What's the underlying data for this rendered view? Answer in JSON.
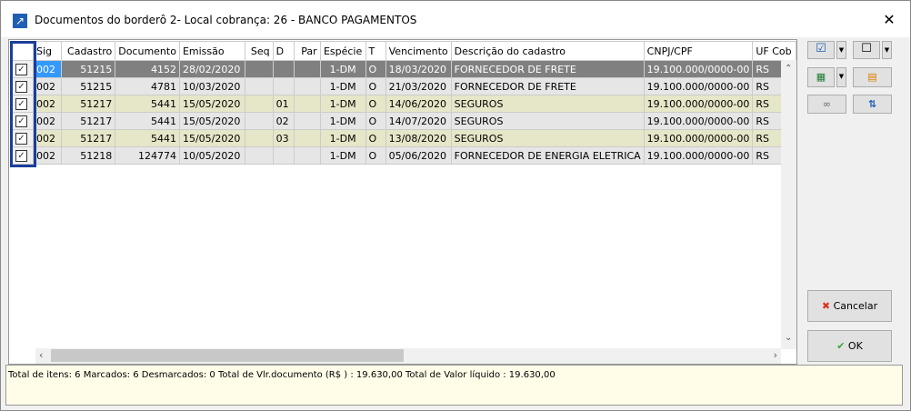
{
  "window": {
    "title": "Documentos do borderô 2- Local cobrança: 26 - BANCO PAGAMENTOS",
    "close": "✕"
  },
  "grid": {
    "headers": [
      "",
      "Sig",
      "Cadastro",
      "Documento",
      "Emissão",
      "Seq",
      "D",
      "Par",
      "Espécie",
      "T",
      "Vencimento",
      "Descrição do cadastro",
      "CNPJ/CPF",
      "UF Cob"
    ],
    "rows": [
      {
        "checked": true,
        "sig": "002",
        "cadastro": "51215",
        "documento": "4152",
        "emissao": "28/02/2020",
        "seq": "",
        "d": "",
        "par": "",
        "especie": "1-DM",
        "t": "O",
        "vencimento": "18/03/2020",
        "descricao": "FORNECEDOR DE FRETE",
        "cnpj": "19.100.000/0000-00",
        "uf": "RS"
      },
      {
        "checked": true,
        "sig": "002",
        "cadastro": "51215",
        "documento": "4781",
        "emissao": "10/03/2020",
        "seq": "",
        "d": "",
        "par": "",
        "especie": "1-DM",
        "t": "O",
        "vencimento": "21/03/2020",
        "descricao": "FORNECEDOR DE FRETE",
        "cnpj": "19.100.000/0000-00",
        "uf": "RS"
      },
      {
        "checked": true,
        "sig": "002",
        "cadastro": "51217",
        "documento": "5441",
        "emissao": "15/05/2020",
        "seq": "",
        "d": "01",
        "par": "",
        "especie": "1-DM",
        "t": "O",
        "vencimento": "14/06/2020",
        "descricao": "SEGUROS",
        "cnpj": "19.100.000/0000-00",
        "uf": "RS"
      },
      {
        "checked": true,
        "sig": "002",
        "cadastro": "51217",
        "documento": "5441",
        "emissao": "15/05/2020",
        "seq": "",
        "d": "02",
        "par": "",
        "especie": "1-DM",
        "t": "O",
        "vencimento": "14/07/2020",
        "descricao": "SEGUROS",
        "cnpj": "19.100.000/0000-00",
        "uf": "RS"
      },
      {
        "checked": true,
        "sig": "002",
        "cadastro": "51217",
        "documento": "5441",
        "emissao": "15/05/2020",
        "seq": "",
        "d": "03",
        "par": "",
        "especie": "1-DM",
        "t": "O",
        "vencimento": "13/08/2020",
        "descricao": "SEGUROS",
        "cnpj": "19.100.000/0000-00",
        "uf": "RS"
      },
      {
        "checked": true,
        "sig": "002",
        "cadastro": "51218",
        "documento": "124774",
        "emissao": "10/05/2020",
        "seq": "",
        "d": "",
        "par": "",
        "especie": "1-DM",
        "t": "O",
        "vencimento": "05/06/2020",
        "descricao": "FORNECEDOR DE ENERGIA ELETRICA",
        "cnpj": "19.100.000/0000-00",
        "uf": "RS"
      }
    ]
  },
  "status": "Total de itens: 6 Marcados: 6 Desmarcados: 0 Total de Vlr.documento (R$ ) : 19.630,00 Total de Valor líquido : 19.630,00",
  "buttons": {
    "cancel": "Cancelar",
    "ok": "OK"
  },
  "colors": {
    "selected_row": "#808080",
    "alt_row": "#e6e6c8",
    "status_bg": "#fffde8",
    "frame": "#1a3e9a"
  }
}
